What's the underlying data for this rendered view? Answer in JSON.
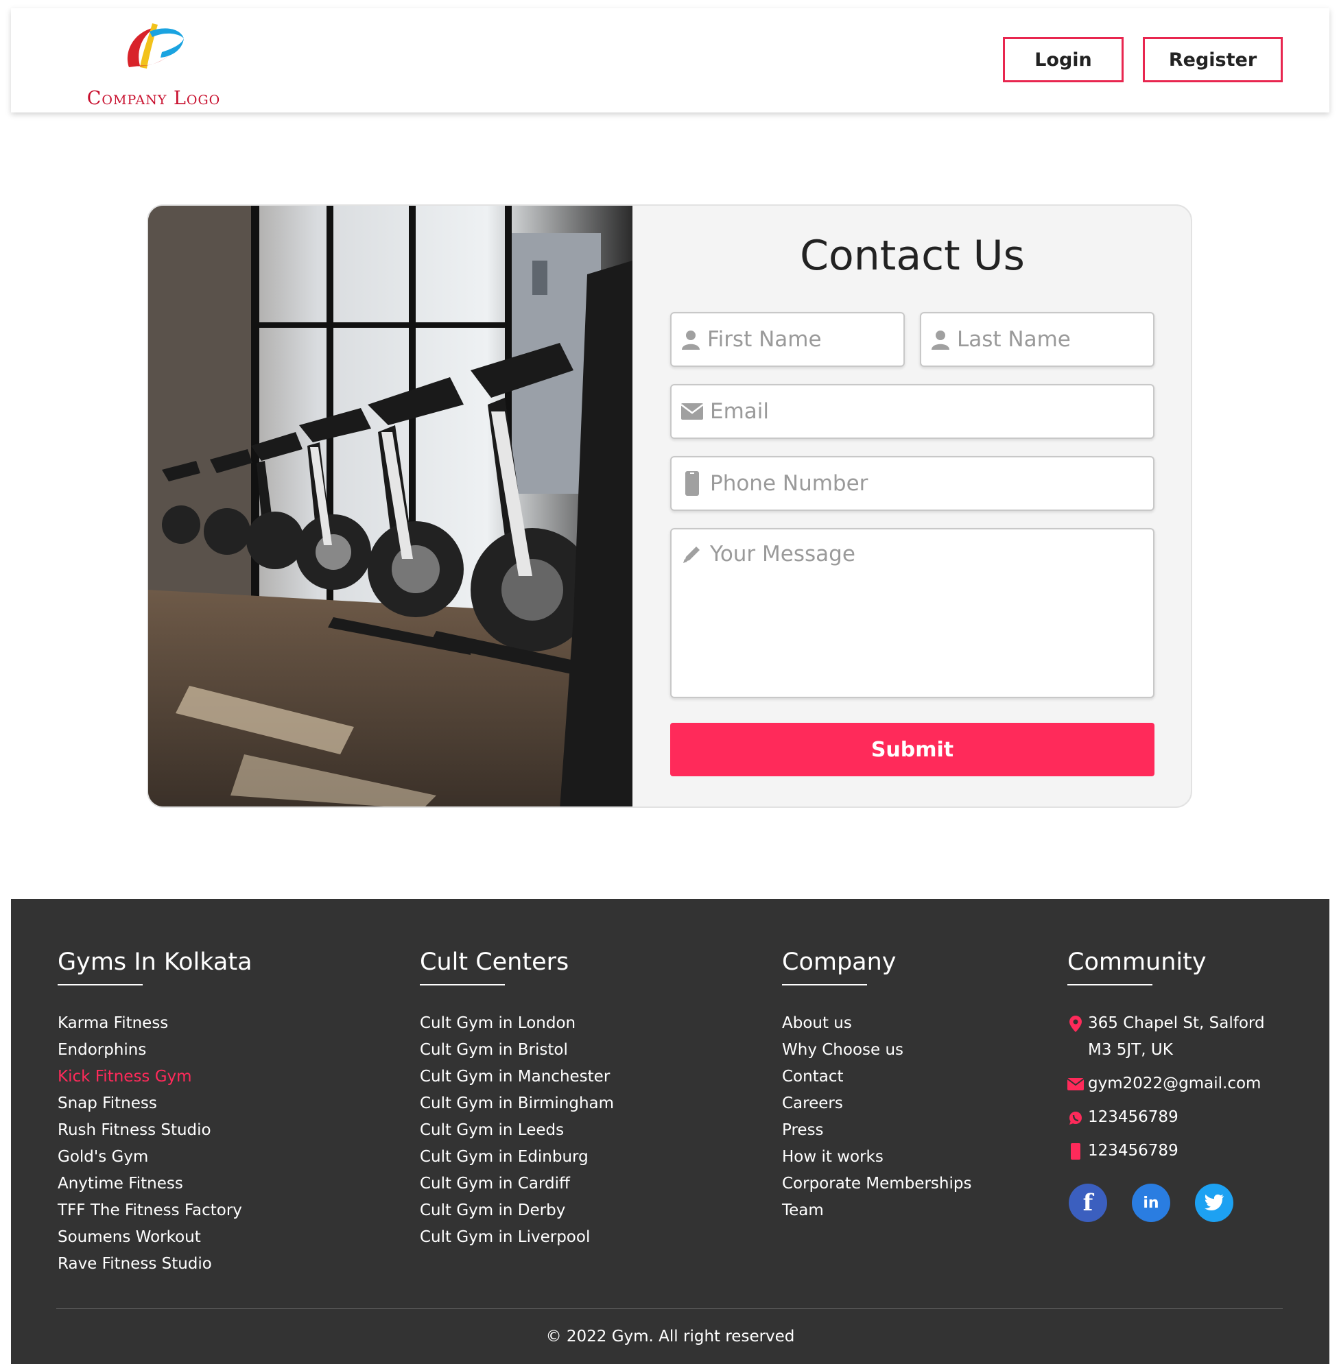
{
  "header": {
    "logo_text": "Company Logo",
    "login_label": "Login",
    "register_label": "Register"
  },
  "contact_form": {
    "title": "Contact Us",
    "first_name_placeholder": "First Name",
    "last_name_placeholder": "Last Name",
    "email_placeholder": "Email",
    "phone_placeholder": "Phone Number",
    "message_placeholder": "Your Message",
    "submit_label": "Submit"
  },
  "footer": {
    "gyms": {
      "heading": "Gyms In Kolkata",
      "items": [
        "Karma Fitness",
        "Endorphins",
        "Kick Fitness Gym",
        "Snap Fitness",
        "Rush Fitness Studio",
        "Gold's Gym",
        "Anytime Fitness",
        "TFF The Fitness Factory",
        "Soumens Workout",
        "Rave Fitness Studio"
      ],
      "active_item": "Kick Fitness Gym"
    },
    "cult": {
      "heading": "Cult Centers",
      "items": [
        "Cult Gym in London",
        "Cult Gym in Bristol",
        "Cult Gym in Manchester",
        "Cult Gym in Birmingham",
        "Cult Gym in Leeds",
        "Cult Gym in Edinburg",
        "Cult Gym in Cardiff",
        "Cult Gym in Derby",
        "Cult Gym in Liverpool"
      ]
    },
    "company": {
      "heading": "Company",
      "items": [
        "About us",
        "Why Choose us",
        "Contact",
        "Careers",
        "Press",
        "How it works",
        "Corporate Memberships",
        "Team"
      ]
    },
    "community": {
      "heading": "Community",
      "address_line1": "365 Chapel St, Salford",
      "address_line2": "M3 5JT, UK",
      "email": "gym2022@gmail.com",
      "whatsapp": "123456789",
      "phone": "123456789",
      "social_icons": [
        "facebook-icon",
        "linkedin-icon",
        "twitter-icon"
      ]
    },
    "copyright": "2022 Gym. All right reserved"
  },
  "colors": {
    "accent": "#ff2a5a",
    "footer_bg": "#333333",
    "card_bg": "#f4f4f4"
  }
}
